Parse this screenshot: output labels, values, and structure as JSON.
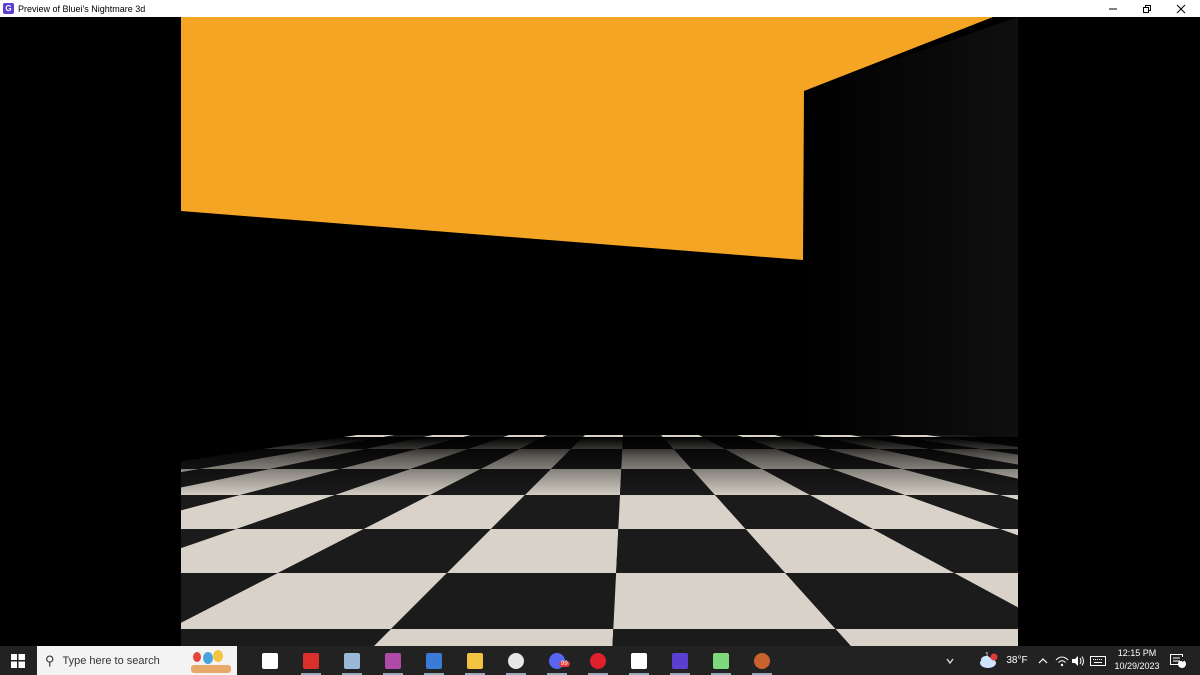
{
  "window": {
    "title": "Preview of Bluei's Nightmare 3d",
    "icon": "gdevelop-icon",
    "controls": [
      "minimize-icon",
      "restore-icon",
      "close-icon"
    ]
  },
  "scene": {
    "ceiling_color": "#f4a524",
    "wall_color": "#000000",
    "floor_light_color": "#d8d2c8",
    "floor_dark_color": "#1b1b1b"
  },
  "taskbar": {
    "search_placeholder": "Type here to search",
    "pinned_apps": [
      "task-view-icon",
      "red-app-icon",
      "mail-app-icon",
      "winrar-icon",
      "calculator-icon",
      "file-explorer-icon",
      "obs-icon",
      "discord-icon",
      "opera-icon",
      "settings-icon",
      "gdevelop-icon",
      "green-bolt-icon",
      "tf2-icon"
    ],
    "discord_badge": "99",
    "weather": {
      "temp": "38°F",
      "badge": "1"
    },
    "clock": {
      "time": "12:15 PM",
      "date": "10/29/2023"
    },
    "notification_count": "4"
  }
}
